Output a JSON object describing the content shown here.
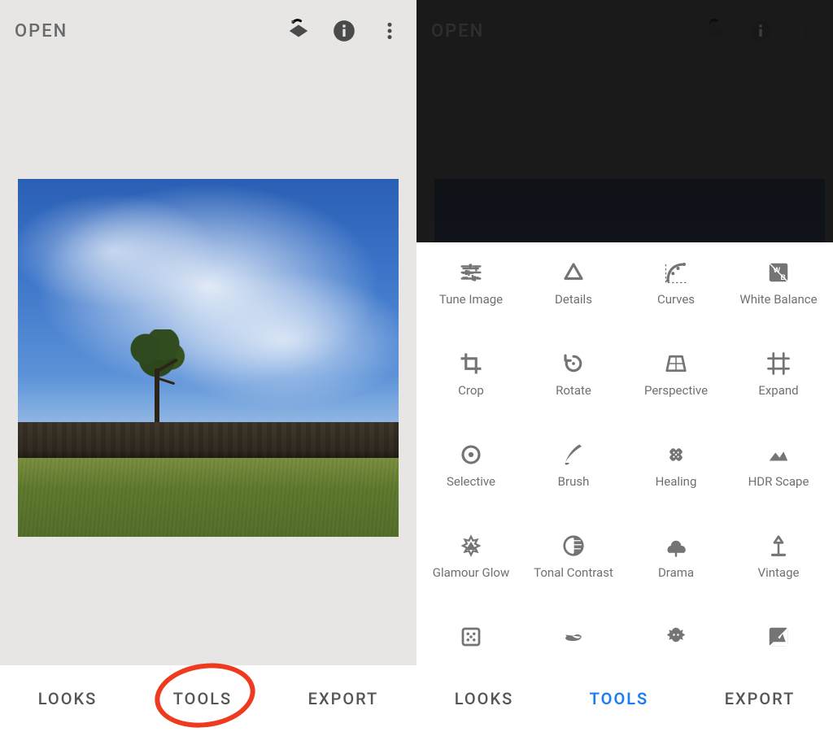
{
  "left": {
    "topbar": {
      "open": "OPEN"
    },
    "nav": {
      "looks": "LOOKS",
      "tools": "TOOLS",
      "export": "EXPORT"
    }
  },
  "right": {
    "topbar": {
      "open": "OPEN"
    },
    "nav": {
      "looks": "LOOKS",
      "tools": "TOOLS",
      "export": "EXPORT",
      "active": "tools"
    },
    "tools": [
      {
        "id": "tune-image",
        "label": "Tune Image"
      },
      {
        "id": "details",
        "label": "Details"
      },
      {
        "id": "curves",
        "label": "Curves"
      },
      {
        "id": "white-balance",
        "label": "White Balance"
      },
      {
        "id": "crop",
        "label": "Crop"
      },
      {
        "id": "rotate",
        "label": "Rotate"
      },
      {
        "id": "perspective",
        "label": "Perspective"
      },
      {
        "id": "expand",
        "label": "Expand"
      },
      {
        "id": "selective",
        "label": "Selective"
      },
      {
        "id": "brush",
        "label": "Brush"
      },
      {
        "id": "healing",
        "label": "Healing"
      },
      {
        "id": "hdr-scape",
        "label": "HDR Scape"
      },
      {
        "id": "glamour-glow",
        "label": "Glamour Glow"
      },
      {
        "id": "tonal-contrast",
        "label": "Tonal Contrast"
      },
      {
        "id": "drama",
        "label": "Drama"
      },
      {
        "id": "vintage",
        "label": "Vintage"
      },
      {
        "id": "grainy-film",
        "label": ""
      },
      {
        "id": "retrolux",
        "label": ""
      },
      {
        "id": "grunge",
        "label": ""
      },
      {
        "id": "bw",
        "label": ""
      }
    ]
  },
  "icons": {
    "layers": "layers-icon",
    "info": "info-icon",
    "more": "more-vert-icon"
  }
}
